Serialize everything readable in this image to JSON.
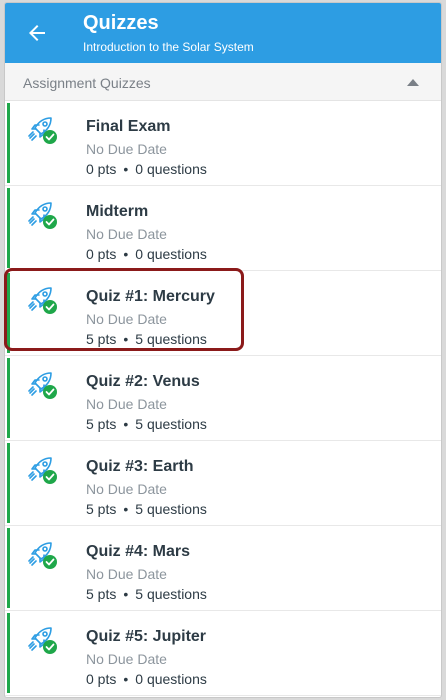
{
  "header": {
    "title": "Quizzes",
    "subtitle": "Introduction to the Solar System",
    "color": "#2d9de3"
  },
  "section": {
    "label": "Assignment Quizzes"
  },
  "quizzes": [
    {
      "name": "Final Exam",
      "due": "No Due Date",
      "pts": "0 pts",
      "questions": "0 questions"
    },
    {
      "name": "Midterm",
      "due": "No Due Date",
      "pts": "0 pts",
      "questions": "0 questions"
    },
    {
      "name": "Quiz #1: Mercury",
      "due": "No Due Date",
      "pts": "5 pts",
      "questions": "5 questions"
    },
    {
      "name": "Quiz #2: Venus",
      "due": "No Due Date",
      "pts": "5 pts",
      "questions": "5 questions"
    },
    {
      "name": "Quiz #3: Earth",
      "due": "No Due Date",
      "pts": "5 pts",
      "questions": "5 questions"
    },
    {
      "name": "Quiz #4: Mars",
      "due": "No Due Date",
      "pts": "5 pts",
      "questions": "5 questions"
    },
    {
      "name": "Quiz #5: Jupiter",
      "due": "No Due Date",
      "pts": "0 pts",
      "questions": "0 questions"
    }
  ],
  "separator": "•",
  "colors": {
    "published": "#1fa74a",
    "icon": "#2d9de3",
    "highlight": "#8b1a1a"
  }
}
